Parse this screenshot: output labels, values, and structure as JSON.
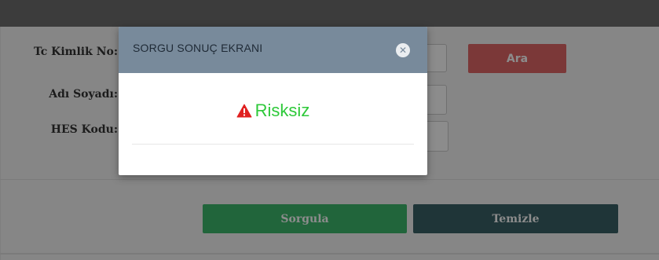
{
  "form": {
    "tc_label": "Tc Kimlik No:",
    "name_label": "Adı Soyadı:",
    "hes_label": "HES Kodu:",
    "search_button": "Ara",
    "query_button": "Sorgula",
    "clear_button": "Temizle"
  },
  "modal": {
    "title": "SORGU SONUÇ EKRANI",
    "close_icon": "close-icon",
    "result_icon": "warning-icon",
    "result_text": "Risksiz"
  },
  "colors": {
    "result_green": "#2ec93a",
    "warning_red": "#e02020",
    "header_bg": "#788a9b",
    "ara_bg": "#e06666",
    "sorgula_bg": "#3cb86c",
    "temizle_bg": "#3a6266"
  }
}
